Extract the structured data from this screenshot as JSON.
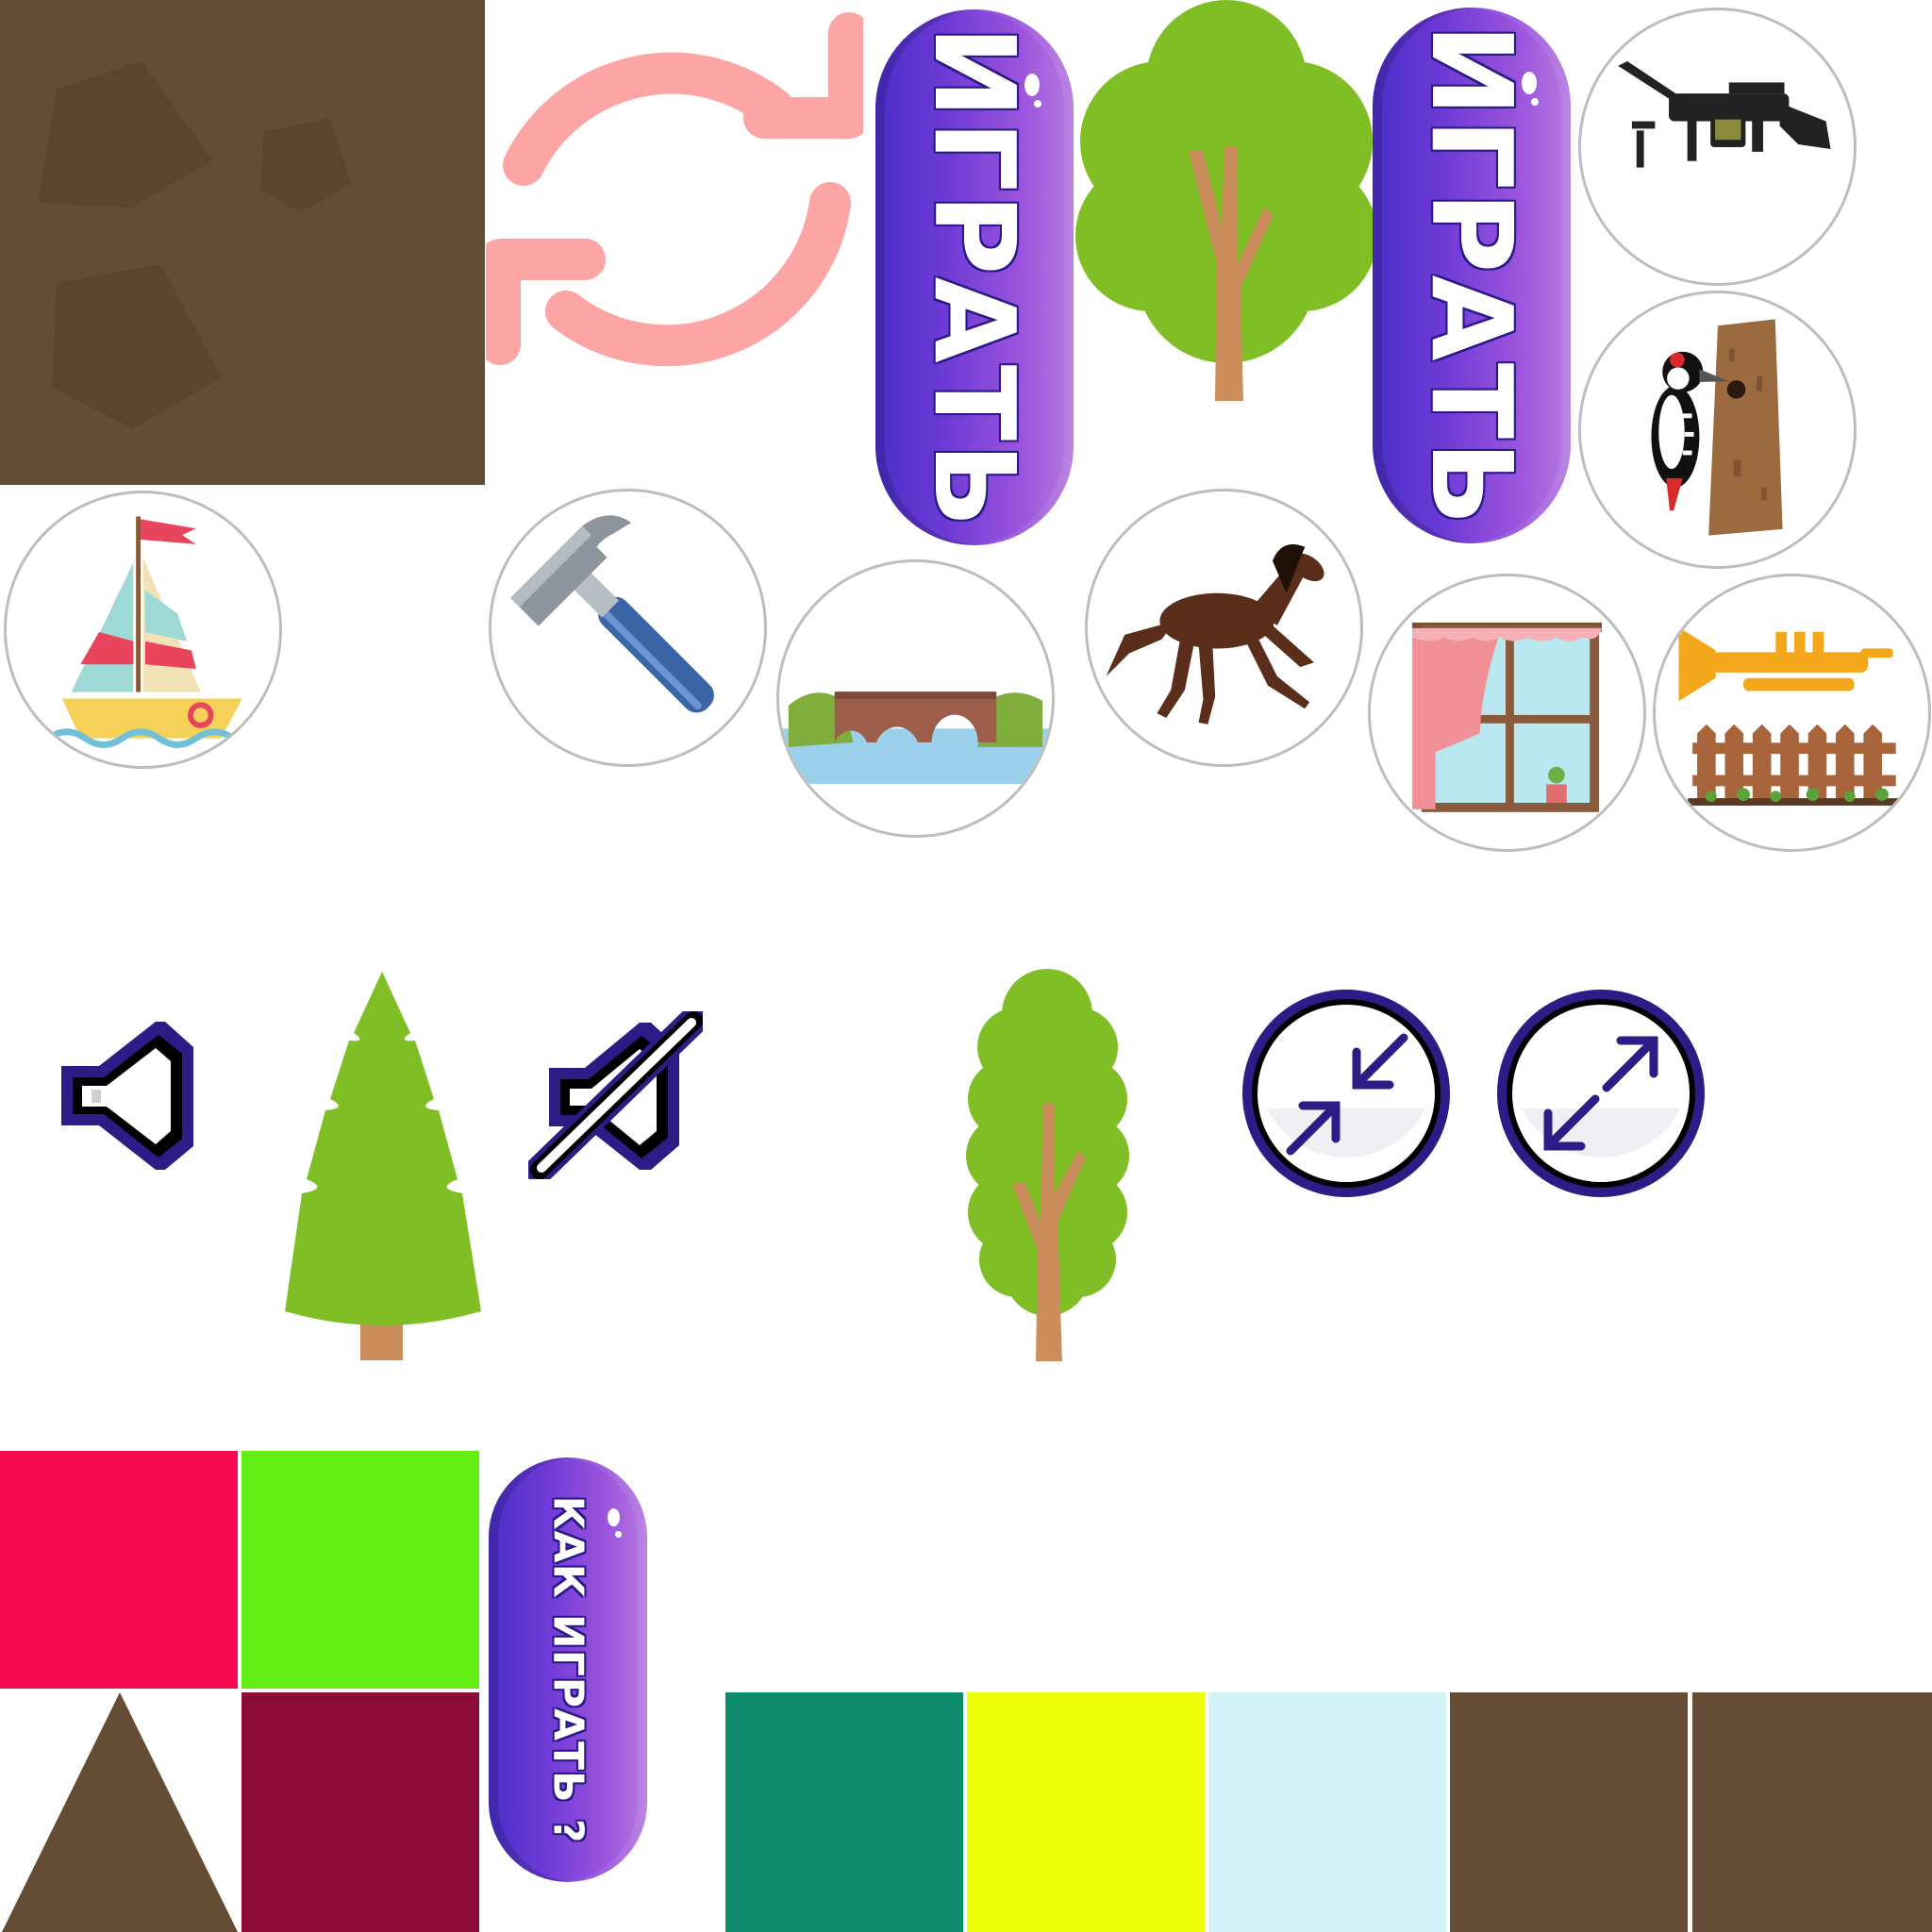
{
  "buttons": {
    "play_label_1": "ИГРАТЬ",
    "play_label_2": "ИГРАТЬ",
    "how_to_play_label": "КАК ИГРАТЬ ?"
  },
  "icons": {
    "reload": "reload-icon",
    "sound_on": "speaker-icon",
    "sound_off": "speaker-muted-icon",
    "shrink": "minimize-icon",
    "expand": "maximize-icon"
  },
  "cards": [
    {
      "id": "machine-gun",
      "icon": "machine-gun-icon"
    },
    {
      "id": "woodpecker",
      "icon": "woodpecker-icon"
    },
    {
      "id": "sailboat",
      "icon": "sailboat-icon"
    },
    {
      "id": "hammer",
      "icon": "hammer-icon"
    },
    {
      "id": "bridge",
      "icon": "bridge-icon"
    },
    {
      "id": "horse",
      "icon": "horse-icon"
    },
    {
      "id": "window",
      "icon": "window-icon"
    },
    {
      "id": "trumpet",
      "icon": "trumpet-icon"
    }
  ],
  "colors": {
    "brown": "#654c35",
    "red": "#f50a4f",
    "lime": "#62ee12",
    "maroon": "#8c0b37",
    "teal": "#0e8b6d",
    "yellow": "#ebff05",
    "light_blue": "#d1f3f7",
    "tree_green": "#80be25",
    "trunk": "#cc8e5d",
    "pill_purple": "#7a3fd8",
    "reload_pink": "#fda4a5"
  }
}
